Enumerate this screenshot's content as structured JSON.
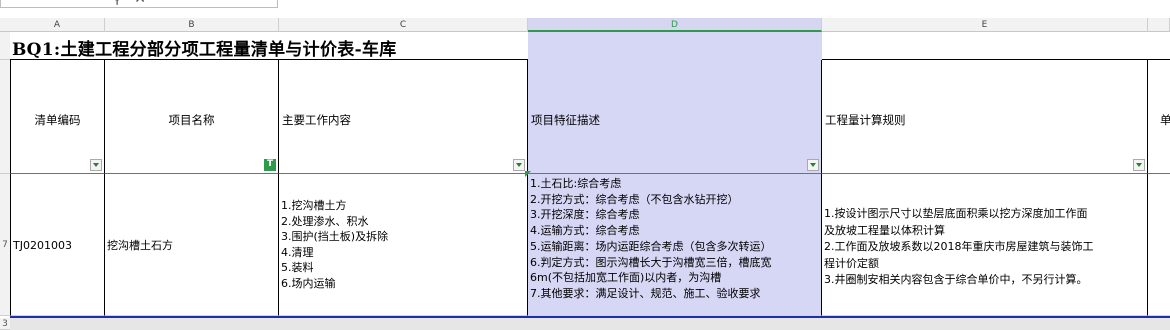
{
  "formula_bar": {
    "icons": [
      "magnify-icon",
      "close-icon"
    ]
  },
  "columns": [
    {
      "letter": "A"
    },
    {
      "letter": "B"
    },
    {
      "letter": "C"
    },
    {
      "letter": "D",
      "selected": true
    },
    {
      "letter": "E"
    }
  ],
  "rows": [
    {
      "number": "7"
    },
    {
      "number": "3"
    }
  ],
  "sheet": {
    "title": "BQ1:土建工程分部分项工程量清单与计价表-车库",
    "headers": [
      "清单编码",
      "项目名称",
      "主要工作内容",
      "项目特征描述",
      "工程量计算规则",
      "单"
    ],
    "row": {
      "code": "TJ0201003",
      "name": "挖沟槽土石方",
      "work_content": "1.挖沟槽土方\n2.处理渗水、积水\n3.围护(挡土板)及拆除\n4.清理\n5.装料\n6.场内运输",
      "features": "1.土石比:综合考虑\n2.开挖方式：综合考虑（不包含水钻开挖）\n3.开挖深度：综合考虑\n4.运输方式：综合考虑\n5.运输距离：场内运距综合考虑（包含多次转运）\n6.判定方式：图示沟槽长大于沟槽宽三倍，槽底宽\n6m(不包括加宽工作面)以内者，为沟槽\n7.其他要求：满足设计、规范、施工、验收要求",
      "calc_rule": "1.按设计图示尺寸以垫层底面积乘以挖方深度加工作面\n及放坡工程量以体积计算\n2.工作面及放坡系数以2018年重庆市房屋建筑与装饰工\n程计价定额\n3.井圈制安相关内容包含于综合单价中，不另行计算。"
    }
  },
  "colors": {
    "selection": "#d6d6f5",
    "accent_green": "#2e9a4e",
    "border_blue": "#1f2fa8"
  }
}
